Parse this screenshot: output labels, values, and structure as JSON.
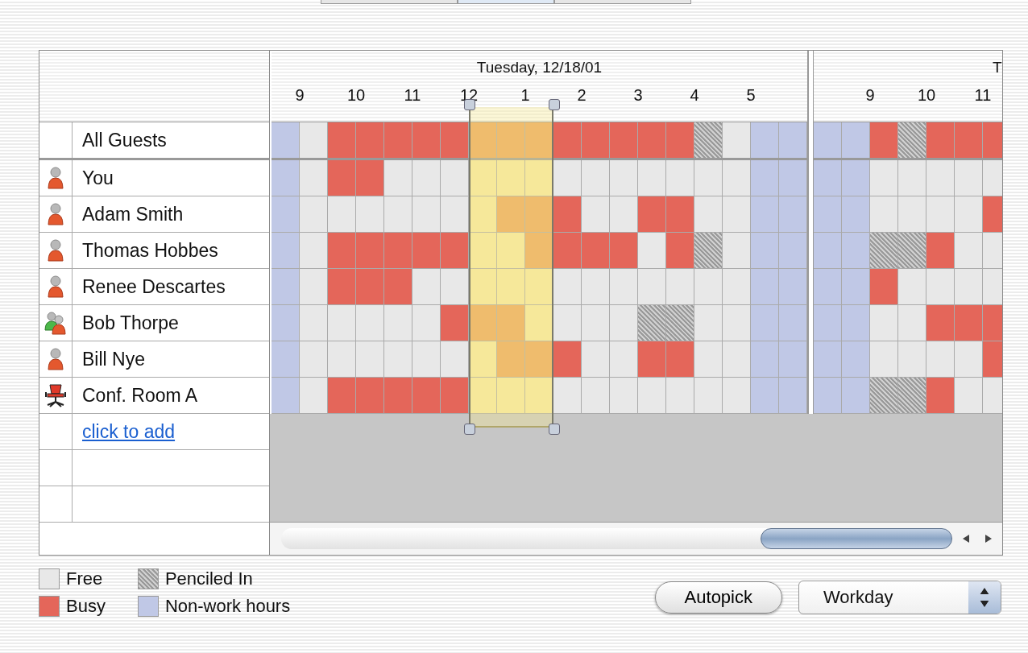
{
  "tabs": [
    {
      "selected": false
    },
    {
      "selected": true
    },
    {
      "selected": false
    }
  ],
  "days": [
    {
      "title": "Tuesday, 12/18/01",
      "slots": [
        {
          "selected": false
        },
        {
          "selected": false,
          "hour": "9"
        },
        {
          "selected": false
        },
        {
          "selected": false,
          "hour": "10"
        },
        {
          "selected": false
        },
        {
          "selected": false,
          "hour": "11"
        },
        {
          "selected": false
        },
        {
          "selected": true,
          "hour": "12"
        },
        {
          "selected": true
        },
        {
          "selected": true,
          "hour": "1"
        },
        {
          "selected": false
        },
        {
          "selected": false,
          "hour": "2"
        },
        {
          "selected": false
        },
        {
          "selected": false,
          "hour": "3"
        },
        {
          "selected": false
        },
        {
          "selected": false,
          "hour": "4"
        },
        {
          "selected": false
        },
        {
          "selected": false,
          "hour": "5"
        },
        {
          "selected": false
        }
      ]
    },
    {
      "title": "T",
      "slots": [
        {
          "selected": false
        },
        {
          "selected": false
        },
        {
          "selected": false,
          "hour": "9"
        },
        {
          "selected": false
        },
        {
          "selected": false,
          "hour": "10"
        },
        {
          "selected": false
        },
        {
          "selected": false,
          "hour": "11"
        }
      ]
    }
  ],
  "rows": [
    {
      "kind": "all",
      "name": "All Guests",
      "schedule": [
        [
          {
            "kind": "off"
          },
          {
            "kind": "free"
          },
          {
            "kind": "busy"
          },
          {
            "kind": "busy"
          },
          {
            "kind": "busy"
          },
          {
            "kind": "busy"
          },
          {
            "kind": "busy"
          },
          {
            "kind": "busy"
          },
          {
            "kind": "busy"
          },
          {
            "kind": "busy"
          },
          {
            "kind": "busy"
          },
          {
            "kind": "busy"
          },
          {
            "kind": "busy"
          },
          {
            "kind": "busy"
          },
          {
            "kind": "busy"
          },
          {
            "kind": "pencil"
          },
          {
            "kind": "free"
          },
          {
            "kind": "off"
          },
          {
            "kind": "off"
          }
        ],
        [
          {
            "kind": "off"
          },
          {
            "kind": "off"
          },
          {
            "kind": "busy"
          },
          {
            "kind": "pencil"
          },
          {
            "kind": "busy"
          },
          {
            "kind": "busy"
          },
          {
            "kind": "busy"
          }
        ]
      ]
    },
    {
      "kind": "person",
      "name": "You",
      "schedule": [
        [
          {
            "kind": "off"
          },
          {
            "kind": "free"
          },
          {
            "kind": "busy"
          },
          {
            "kind": "busy"
          },
          {
            "kind": "free"
          },
          {
            "kind": "free"
          },
          {
            "kind": "free"
          },
          {
            "kind": "free"
          },
          {
            "kind": "free"
          },
          {
            "kind": "free"
          },
          {
            "kind": "free"
          },
          {
            "kind": "free"
          },
          {
            "kind": "free"
          },
          {
            "kind": "free"
          },
          {
            "kind": "free"
          },
          {
            "kind": "free"
          },
          {
            "kind": "free"
          },
          {
            "kind": "off"
          },
          {
            "kind": "off"
          }
        ],
        [
          {
            "kind": "off"
          },
          {
            "kind": "off"
          },
          {
            "kind": "free"
          },
          {
            "kind": "free"
          },
          {
            "kind": "free"
          },
          {
            "kind": "free"
          },
          {
            "kind": "free"
          }
        ]
      ]
    },
    {
      "kind": "person",
      "name": "Adam Smith",
      "schedule": [
        [
          {
            "kind": "off"
          },
          {
            "kind": "free"
          },
          {
            "kind": "free"
          },
          {
            "kind": "free"
          },
          {
            "kind": "free"
          },
          {
            "kind": "free"
          },
          {
            "kind": "free"
          },
          {
            "kind": "free"
          },
          {
            "kind": "busy"
          },
          {
            "kind": "busy"
          },
          {
            "kind": "busy"
          },
          {
            "kind": "free"
          },
          {
            "kind": "free"
          },
          {
            "kind": "busy"
          },
          {
            "kind": "busy"
          },
          {
            "kind": "free"
          },
          {
            "kind": "free"
          },
          {
            "kind": "off"
          },
          {
            "kind": "off"
          }
        ],
        [
          {
            "kind": "off"
          },
          {
            "kind": "off"
          },
          {
            "kind": "free"
          },
          {
            "kind": "free"
          },
          {
            "kind": "free"
          },
          {
            "kind": "free"
          },
          {
            "kind": "busy"
          }
        ]
      ]
    },
    {
      "kind": "person",
      "name": "Thomas Hobbes",
      "schedule": [
        [
          {
            "kind": "off"
          },
          {
            "kind": "free"
          },
          {
            "kind": "busy"
          },
          {
            "kind": "busy"
          },
          {
            "kind": "busy"
          },
          {
            "kind": "busy"
          },
          {
            "kind": "busy"
          },
          {
            "kind": "free"
          },
          {
            "kind": "free"
          },
          {
            "kind": "busy"
          },
          {
            "kind": "busy"
          },
          {
            "kind": "busy"
          },
          {
            "kind": "busy"
          },
          {
            "kind": "free"
          },
          {
            "kind": "busy"
          },
          {
            "kind": "pencil"
          },
          {
            "kind": "free"
          },
          {
            "kind": "off"
          },
          {
            "kind": "off"
          }
        ],
        [
          {
            "kind": "off"
          },
          {
            "kind": "off"
          },
          {
            "kind": "pencil"
          },
          {
            "kind": "pencil"
          },
          {
            "kind": "busy"
          },
          {
            "kind": "free"
          },
          {
            "kind": "free"
          }
        ]
      ]
    },
    {
      "kind": "person",
      "name": "Renee Descartes",
      "schedule": [
        [
          {
            "kind": "off"
          },
          {
            "kind": "free"
          },
          {
            "kind": "busy"
          },
          {
            "kind": "busy"
          },
          {
            "kind": "busy"
          },
          {
            "kind": "free"
          },
          {
            "kind": "free"
          },
          {
            "kind": "free"
          },
          {
            "kind": "free"
          },
          {
            "kind": "free"
          },
          {
            "kind": "free"
          },
          {
            "kind": "free"
          },
          {
            "kind": "free"
          },
          {
            "kind": "free"
          },
          {
            "kind": "free"
          },
          {
            "kind": "free"
          },
          {
            "kind": "free"
          },
          {
            "kind": "off"
          },
          {
            "kind": "off"
          }
        ],
        [
          {
            "kind": "off"
          },
          {
            "kind": "off"
          },
          {
            "kind": "busy"
          },
          {
            "kind": "free"
          },
          {
            "kind": "free"
          },
          {
            "kind": "free"
          },
          {
            "kind": "free"
          }
        ]
      ]
    },
    {
      "kind": "group",
      "name": "Bob Thorpe",
      "schedule": [
        [
          {
            "kind": "off"
          },
          {
            "kind": "free"
          },
          {
            "kind": "free"
          },
          {
            "kind": "free"
          },
          {
            "kind": "free"
          },
          {
            "kind": "free"
          },
          {
            "kind": "busy"
          },
          {
            "kind": "busy"
          },
          {
            "kind": "busy"
          },
          {
            "kind": "free"
          },
          {
            "kind": "free"
          },
          {
            "kind": "free"
          },
          {
            "kind": "free"
          },
          {
            "kind": "pencil"
          },
          {
            "kind": "pencil"
          },
          {
            "kind": "free"
          },
          {
            "kind": "free"
          },
          {
            "kind": "off"
          },
          {
            "kind": "off"
          }
        ],
        [
          {
            "kind": "off"
          },
          {
            "kind": "off"
          },
          {
            "kind": "free"
          },
          {
            "kind": "free"
          },
          {
            "kind": "busy"
          },
          {
            "kind": "busy"
          },
          {
            "kind": "busy"
          }
        ]
      ]
    },
    {
      "kind": "person",
      "name": "Bill Nye",
      "schedule": [
        [
          {
            "kind": "off"
          },
          {
            "kind": "free"
          },
          {
            "kind": "free"
          },
          {
            "kind": "free"
          },
          {
            "kind": "free"
          },
          {
            "kind": "free"
          },
          {
            "kind": "free"
          },
          {
            "kind": "free"
          },
          {
            "kind": "busy"
          },
          {
            "kind": "busy"
          },
          {
            "kind": "busy"
          },
          {
            "kind": "free"
          },
          {
            "kind": "free"
          },
          {
            "kind": "busy"
          },
          {
            "kind": "busy"
          },
          {
            "kind": "free"
          },
          {
            "kind": "free"
          },
          {
            "kind": "off"
          },
          {
            "kind": "off"
          }
        ],
        [
          {
            "kind": "off"
          },
          {
            "kind": "off"
          },
          {
            "kind": "free"
          },
          {
            "kind": "free"
          },
          {
            "kind": "free"
          },
          {
            "kind": "free"
          },
          {
            "kind": "busy"
          }
        ]
      ]
    },
    {
      "kind": "room",
      "name": "Conf. Room A",
      "schedule": [
        [
          {
            "kind": "off"
          },
          {
            "kind": "free"
          },
          {
            "kind": "busy"
          },
          {
            "kind": "busy"
          },
          {
            "kind": "busy"
          },
          {
            "kind": "busy"
          },
          {
            "kind": "busy"
          },
          {
            "kind": "free"
          },
          {
            "kind": "free"
          },
          {
            "kind": "free"
          },
          {
            "kind": "free"
          },
          {
            "kind": "free"
          },
          {
            "kind": "free"
          },
          {
            "kind": "free"
          },
          {
            "kind": "free"
          },
          {
            "kind": "free"
          },
          {
            "kind": "free"
          },
          {
            "kind": "off"
          },
          {
            "kind": "off"
          }
        ],
        [
          {
            "kind": "off"
          },
          {
            "kind": "off"
          },
          {
            "kind": "pencil"
          },
          {
            "kind": "pencil"
          },
          {
            "kind": "busy"
          },
          {
            "kind": "free"
          },
          {
            "kind": "free"
          }
        ]
      ]
    }
  ],
  "add_link": "click to add",
  "legend": [
    {
      "kind": "free",
      "label": "Free"
    },
    {
      "kind": "busy",
      "label": "Busy"
    },
    {
      "kind": "pencil",
      "label": "Penciled In"
    },
    {
      "kind": "off",
      "label": "Non-work hours"
    }
  ],
  "autopick_button": "Autopick",
  "range_popup": {
    "value": "Workday"
  }
}
